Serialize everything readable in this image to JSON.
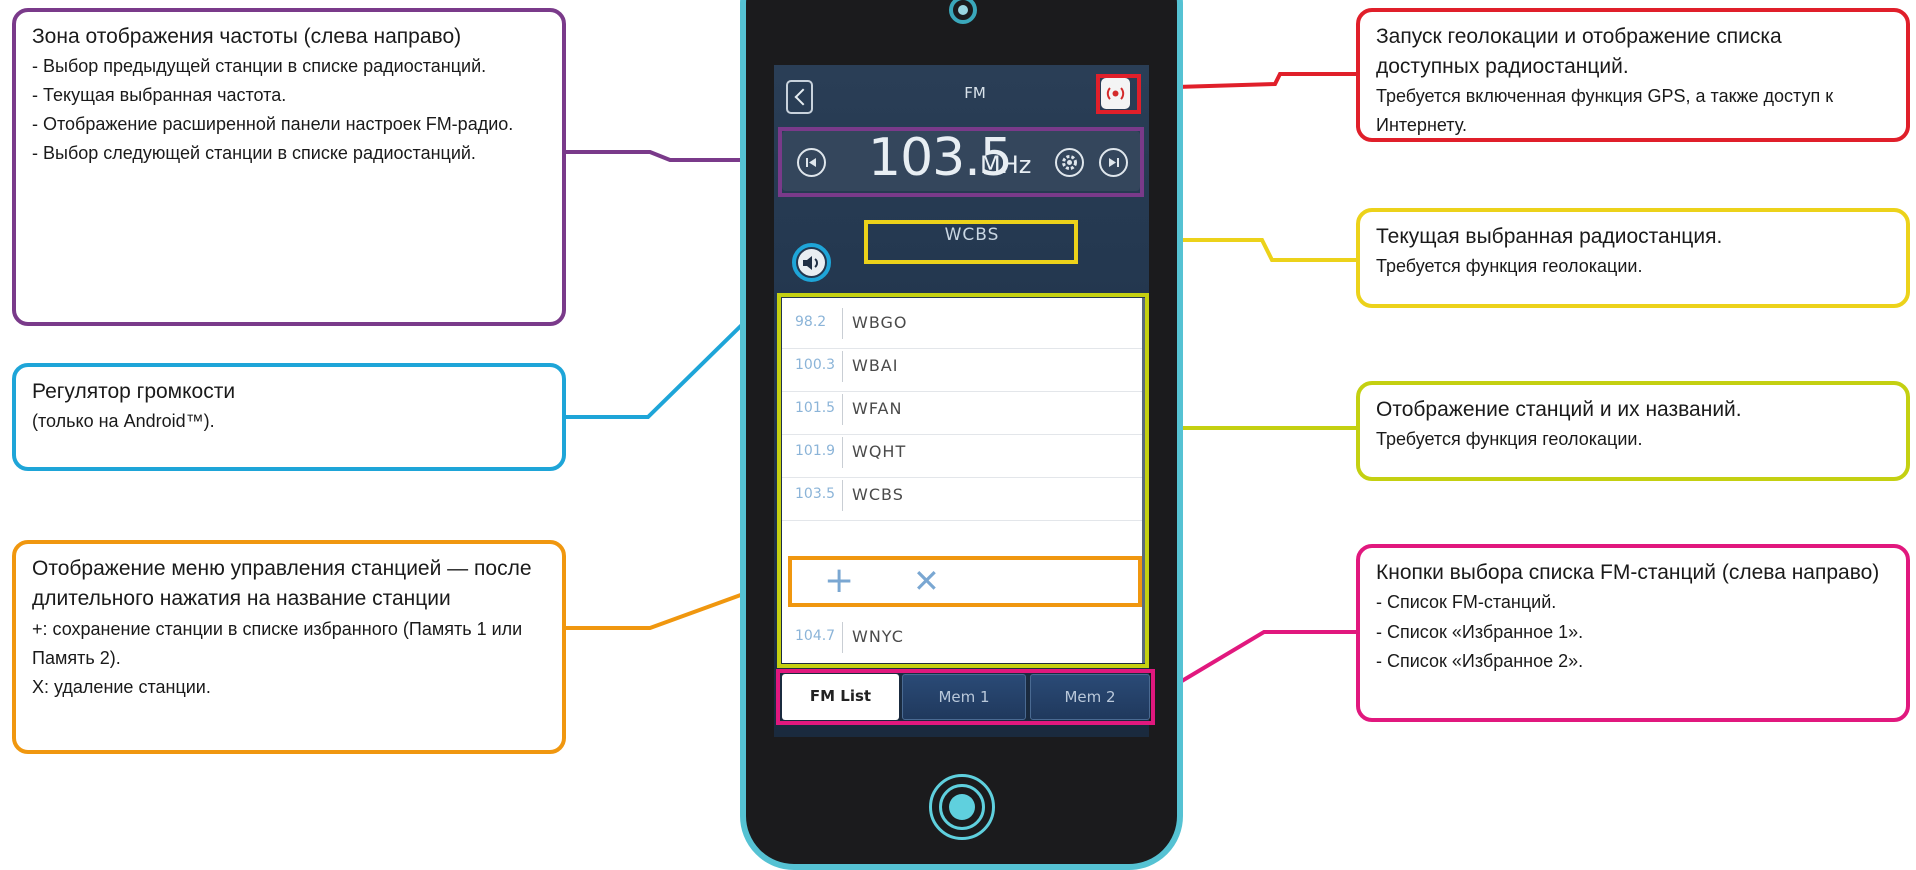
{
  "callouts": {
    "freq": {
      "title": "Зона отображения частоты (слева направо)",
      "items": [
        "- Выбор предыдущей станции в списке радиостанций.",
        "- Текущая выбранная частота.",
        "- Отображение расширенной панели настроек FM-радио.",
        "- Выбор следующей станции в списке радиостанций."
      ]
    },
    "volume": {
      "title": "Регулятор громкости",
      "note": "(только на Android™)."
    },
    "menu": {
      "title": "Отображение меню управления станцией — после длительного нажатия на название станции",
      "items": [
        "+: сохранение станции в списке избранного (Память 1 или Память 2).",
        "X: удаление станции."
      ]
    },
    "geo": {
      "title": "Запуск геолокации и отображение списка доступных радиостанций.",
      "note": "Требуется включенная функция GPS, а также доступ к Интернету."
    },
    "current": {
      "title": "Текущая выбранная радиостанция.",
      "note": "Требуется функция геолокации."
    },
    "list": {
      "title": "Отображение станций и их названий.",
      "note": "Требуется функция геолокации."
    },
    "buttons": {
      "title": "Кнопки выбора списка FM-станций (слева направо)",
      "items": [
        "- Список FM-станций.",
        "- Список «Избранное 1».",
        "- Список «Избранное 2»."
      ]
    }
  },
  "app": {
    "title": "FM",
    "frequency": "103.5",
    "unit": "MHz",
    "current_station": "WCBS",
    "stations": [
      {
        "freq": "98.2",
        "name": "WBGO"
      },
      {
        "freq": "100.3",
        "name": "WBAI"
      },
      {
        "freq": "101.5",
        "name": "WFAN"
      },
      {
        "freq": "101.9",
        "name": "WQHT"
      },
      {
        "freq": "103.5",
        "name": "WCBS"
      },
      {
        "freq": "104.7",
        "name": "WNYC"
      }
    ],
    "menu": {
      "add": "+",
      "delete": "✕"
    },
    "tabs": [
      "FM List",
      "Mem 1",
      "Mem 2"
    ]
  },
  "colors": {
    "freq": "#7a3a8a",
    "volume": "#1ea5d8",
    "menu": "#f0970f",
    "geo": "#e01f2a",
    "current": "#ecd21a",
    "list": "#c4d011",
    "buttons": "#e1187e",
    "phone_border": "#55c2d3"
  }
}
